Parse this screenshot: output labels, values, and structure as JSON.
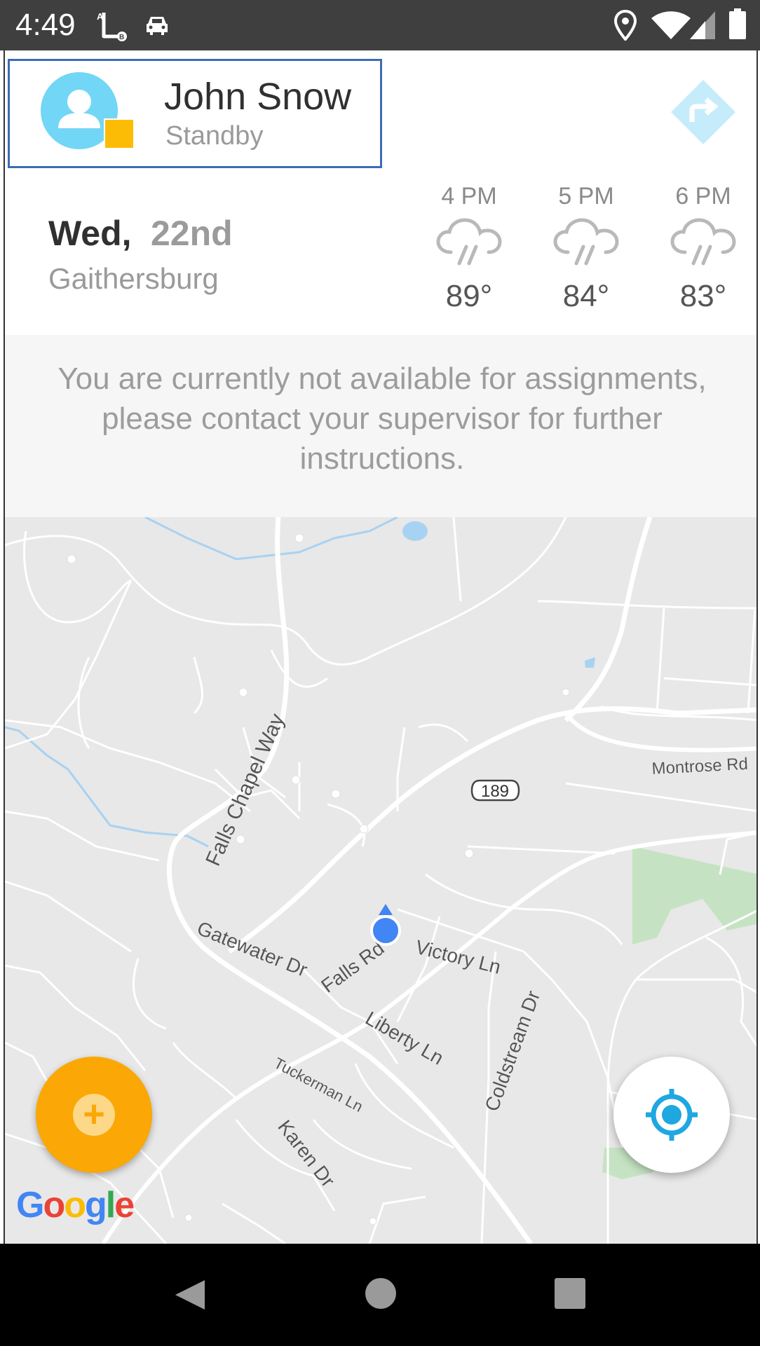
{
  "status_bar": {
    "time": "4:49",
    "icons": [
      "ab-app-icon",
      "car-icon",
      "location-pin-icon",
      "wifi-icon",
      "cell-signal-icon",
      "battery-icon"
    ]
  },
  "profile": {
    "name": "John Snow",
    "status": "Standby",
    "avatar_icon": "person-icon",
    "status_color": "#fcbc06"
  },
  "navigate_button": {
    "icon": "turn-right-diamond-icon",
    "color": "#c6ecfb"
  },
  "date": {
    "day": "Wed,",
    "date": "22nd",
    "city": "Gaithersburg"
  },
  "forecast": [
    {
      "hour": "4 PM",
      "icon": "rain-cloud-icon",
      "temp": "89°"
    },
    {
      "hour": "5 PM",
      "icon": "rain-cloud-icon",
      "temp": "84°"
    },
    {
      "hour": "6 PM",
      "icon": "rain-cloud-icon",
      "temp": "83°"
    }
  ],
  "notice": {
    "line1": "You are currently not available for assignments,",
    "line2": "please contact your supervisor for further",
    "line3": "instructions."
  },
  "map": {
    "labels": {
      "falls_chapel": "Falls Chapel Way",
      "montrose": "Montrose Rd",
      "route": "189",
      "gatewater": "Gatewater Dr",
      "falls_rd": "Falls Rd",
      "victory": "Victory Ln",
      "liberty": "Liberty Ln",
      "coldstream": "Coldstream Dr",
      "tuckerman": "Tuckerman Ln",
      "karen": "Karen Dr"
    },
    "attribution": "Google"
  },
  "fab_add": {
    "symbol": "+",
    "icon": "plus-icon",
    "color": "#fba705"
  },
  "fab_locate": {
    "icon": "crosshair-locate-icon",
    "color": "#1ea7e1"
  },
  "nav_bar": {
    "icons": [
      "back-icon",
      "home-icon",
      "recents-icon"
    ]
  }
}
